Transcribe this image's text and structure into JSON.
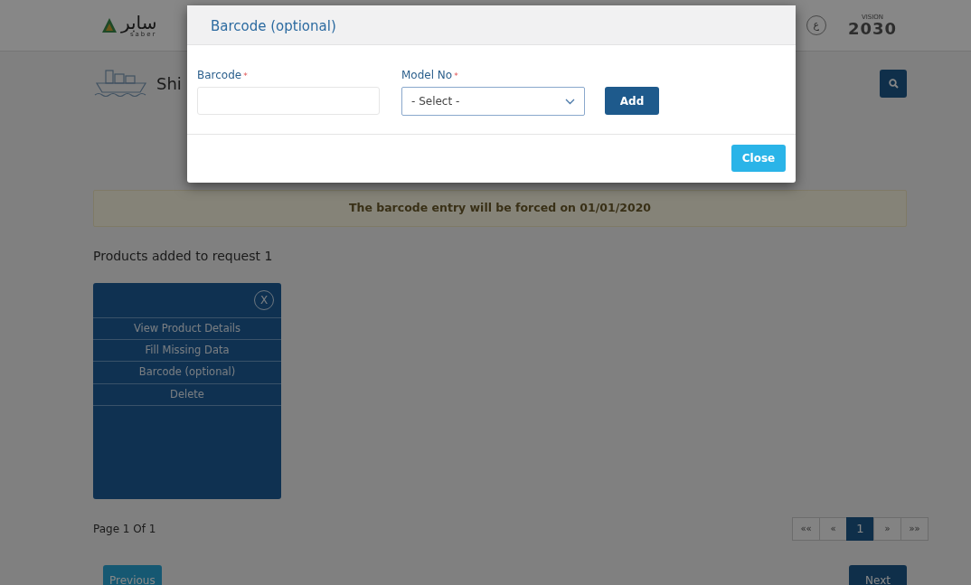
{
  "header": {
    "logo_arabic": "سابر",
    "logo_latin": "saber",
    "language_button": "ع",
    "vision_top": "VISION",
    "vision_number": "2030"
  },
  "page_title": "Shi",
  "notice": "The barcode entry will be forced on 01/01/2020",
  "products_heading": "Products added to request 1",
  "product_menu": {
    "close": "X",
    "items": [
      {
        "label": "View Product Details"
      },
      {
        "label": "Fill Missing Data"
      },
      {
        "label": "Barcode (optional)"
      },
      {
        "label": "Delete"
      }
    ]
  },
  "page_info": "Page 1 Of 1",
  "pagination": [
    {
      "label": "««",
      "selected": false
    },
    {
      "label": "«",
      "selected": false
    },
    {
      "label": "1",
      "selected": true
    },
    {
      "label": "»",
      "selected": false
    },
    {
      "label": "»»",
      "selected": false
    }
  ],
  "previous_button": "Previous",
  "next_button": "Next",
  "modal": {
    "title": "Barcode (optional)",
    "fields": [
      {
        "kind": "text",
        "label": "Barcode",
        "required_mark": "*"
      },
      {
        "kind": "select",
        "label": "Model No",
        "required_mark": "*",
        "value": "- Select -"
      }
    ],
    "add_button": "Add",
    "close_button": "Close"
  }
}
